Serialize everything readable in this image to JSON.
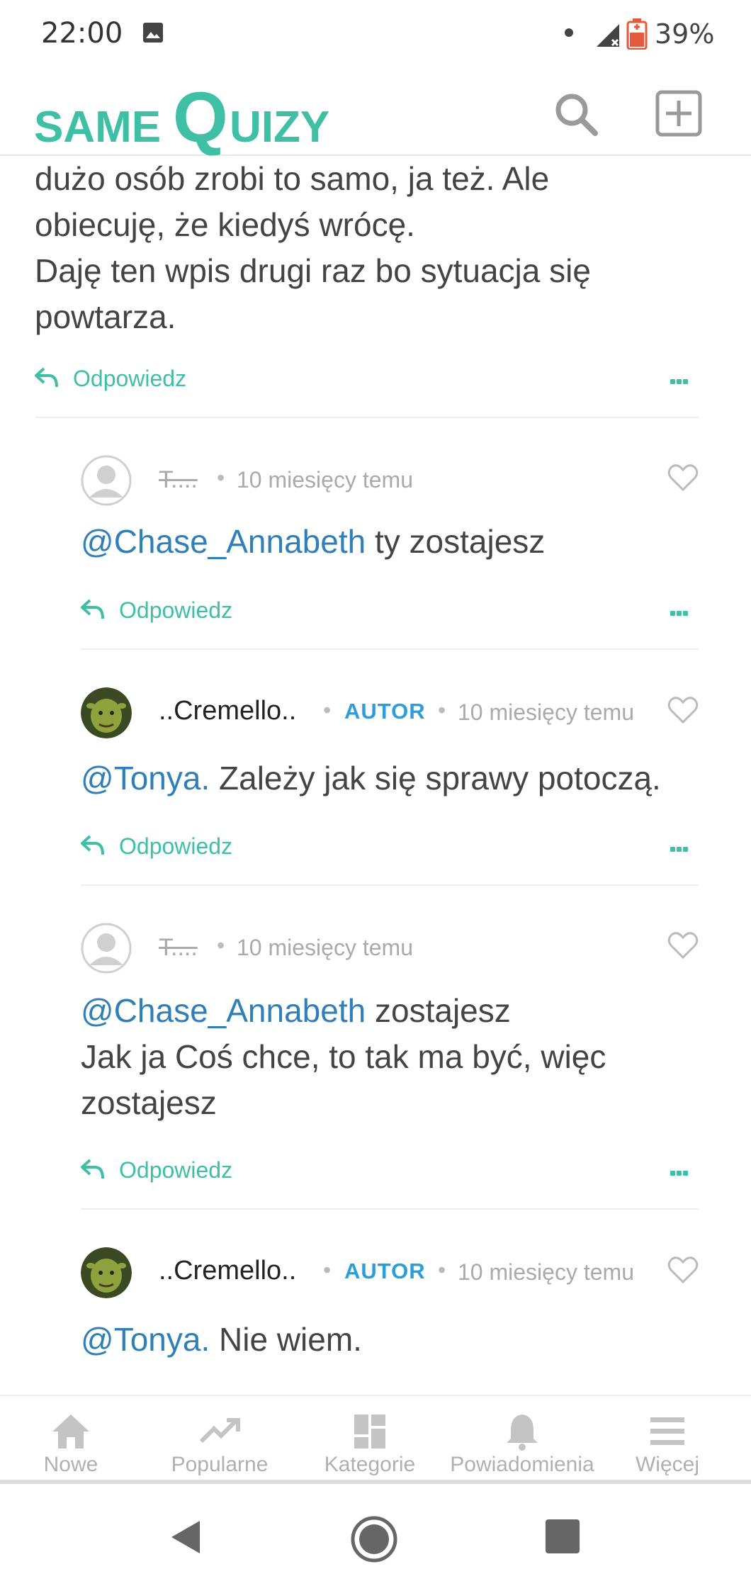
{
  "status_bar": {
    "time": "22:00",
    "battery": "39%",
    "icons": [
      "image-icon",
      "signal-icon",
      "battery-icon"
    ]
  },
  "app": {
    "logo_text_left": "SAME",
    "logo_text_q": "Q",
    "logo_text_right": "UIZY",
    "brand_color": "#3fbfa6"
  },
  "post": {
    "lines": [
      "dużo osób zrobi to samo, ja też. Ale",
      "obiecuję, że kiedyś wrócę.",
      "Daję ten wpis drugi raz bo sytuacja się",
      "powtarza."
    ],
    "reply_label": "Odpowiedz"
  },
  "comments": [
    {
      "author": "T....",
      "timestamp": "10 miesięcy temu",
      "mention": "@Chase_Annabeth",
      "text": " ty zostajesz",
      "reply_label": "Odpowiedz"
    },
    {
      "author": "..Cremello..",
      "badge": "AUTOR",
      "timestamp": "10 miesięcy temu",
      "mention": "@Tonya.",
      "text": " Zależy jak się sprawy potoczą.",
      "reply_label": "Odpowiedz"
    },
    {
      "author": "T....",
      "timestamp": "10 miesięcy temu",
      "mention": "@Chase_Annabeth",
      "text": " zostajesz",
      "line2": "Jak ja Coś chce, to tak ma być, więc",
      "line3": "zostajesz",
      "reply_label": "Odpowiedz"
    },
    {
      "author": "..Cremello..",
      "badge": "AUTOR",
      "timestamp": "10 miesięcy temu",
      "mention": "@Tonya.",
      "text": " Nie wiem."
    }
  ],
  "separator": "•",
  "bottom_nav": [
    {
      "label": "Nowe",
      "icon": "home-icon"
    },
    {
      "label": "Popularne",
      "icon": "trending-icon"
    },
    {
      "label": "Kategorie",
      "icon": "grid-icon"
    },
    {
      "label": "Powiadomienia",
      "icon": "bell-icon"
    },
    {
      "label": "Więcej",
      "icon": "menu-icon"
    }
  ]
}
